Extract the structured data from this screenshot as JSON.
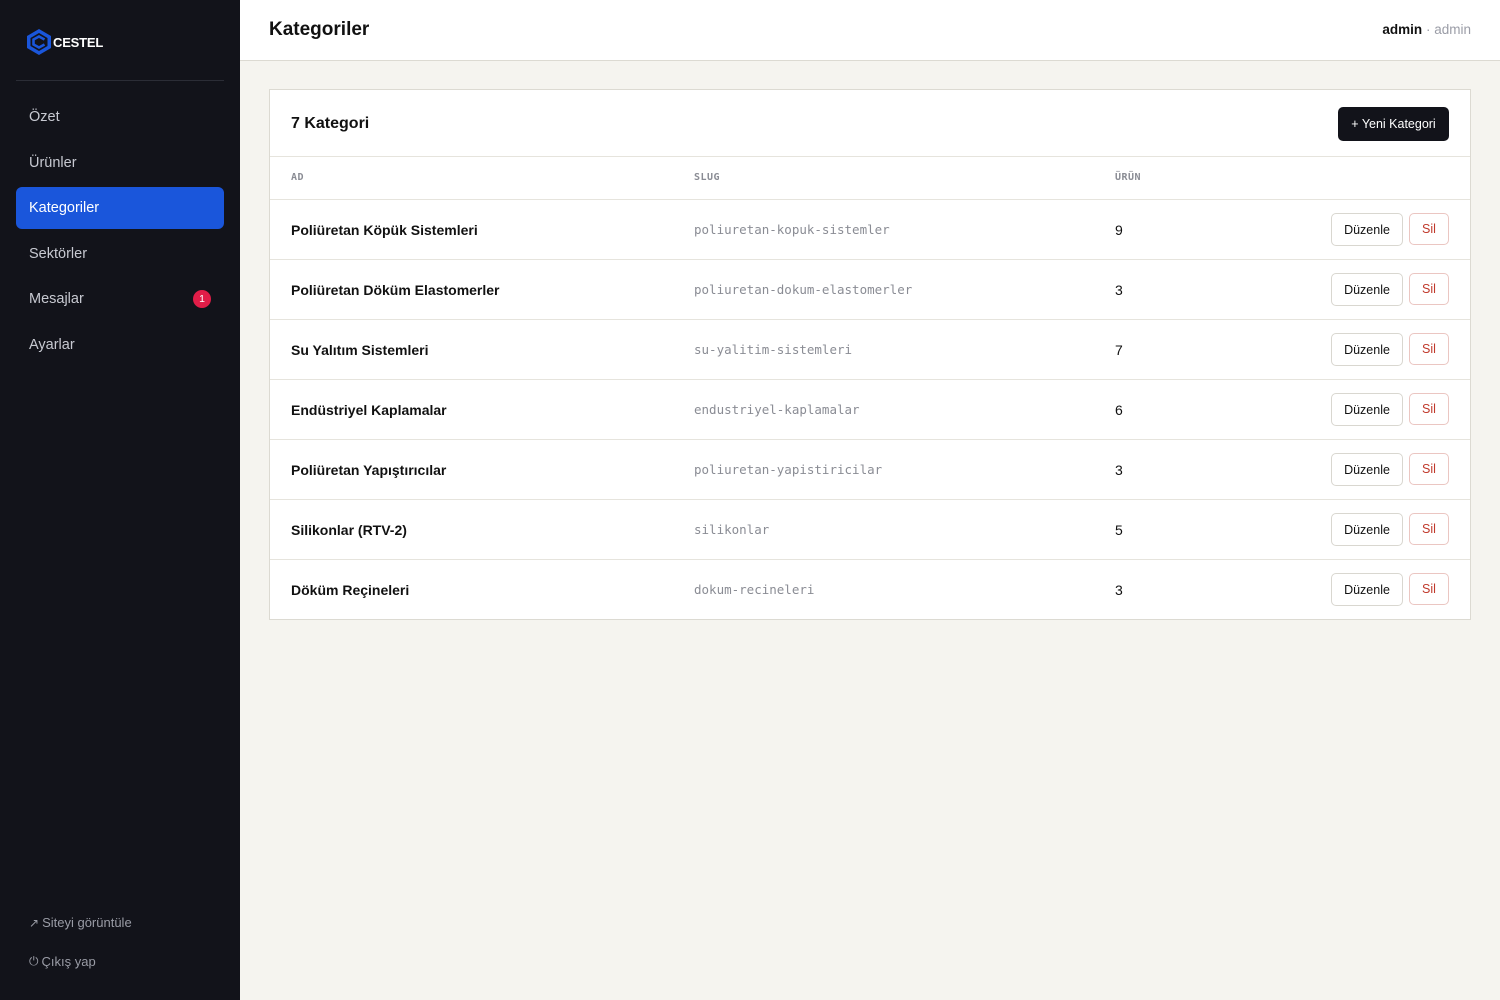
{
  "brand": {
    "name": "CESTEL",
    "logo_icon": "cube-c-logo-icon",
    "accent": "#1a56db"
  },
  "sidebar": {
    "items": [
      {
        "key": "ozet",
        "label": "Özet",
        "active": false
      },
      {
        "key": "urunler",
        "label": "Ürünler",
        "active": false
      },
      {
        "key": "kategoriler",
        "label": "Kategoriler",
        "active": true
      },
      {
        "key": "sektorler",
        "label": "Sektörler",
        "active": false
      },
      {
        "key": "mesajlar",
        "label": "Mesajlar",
        "active": false,
        "badge": "1"
      },
      {
        "key": "ayarlar",
        "label": "Ayarlar",
        "active": false
      }
    ],
    "footer": {
      "view_site": {
        "icon": "external-link-icon",
        "glyph": "↗",
        "label": "Siteyi görüntüle"
      },
      "logout": {
        "icon": "power-icon",
        "glyph": "⏻",
        "label": "Çıkış yap"
      }
    }
  },
  "header": {
    "title": "Kategoriler",
    "user": {
      "name": "admin",
      "separator": "·",
      "role": "admin"
    }
  },
  "card": {
    "title": "7 Kategori",
    "new_button": "+ Yeni Kategori"
  },
  "table": {
    "columns": {
      "name": "AD",
      "slug": "SLUG",
      "count": "ÜRÜN"
    },
    "edit_label": "Düzenle",
    "delete_label": "Sil",
    "rows": [
      {
        "name": "Poliüretan Köpük Sistemleri",
        "slug": "poliuretan-kopuk-sistemler",
        "count": "9"
      },
      {
        "name": "Poliüretan Döküm Elastomerler",
        "slug": "poliuretan-dokum-elastomerler",
        "count": "3"
      },
      {
        "name": "Su Yalıtım Sistemleri",
        "slug": "su-yalitim-sistemleri",
        "count": "7"
      },
      {
        "name": "Endüstriyel Kaplamalar",
        "slug": "endustriyel-kaplamalar",
        "count": "6"
      },
      {
        "name": "Poliüretan Yapıştırıcılar",
        "slug": "poliuretan-yapistiricilar",
        "count": "3"
      },
      {
        "name": "Silikonlar (RTV-2)",
        "slug": "silikonlar",
        "count": "5"
      },
      {
        "name": "Döküm Reçineleri",
        "slug": "dokum-recineleri",
        "count": "3"
      }
    ]
  }
}
